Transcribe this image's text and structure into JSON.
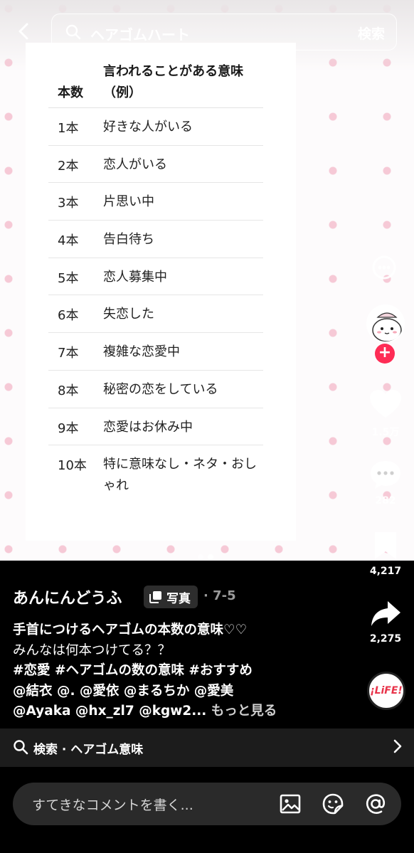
{
  "search": {
    "query": "ヘアゴムハート",
    "button_label": "検索"
  },
  "table": {
    "header_num": "本数",
    "header_meaning_1": "言われることがある意味",
    "header_meaning_2": "（例）",
    "rows": [
      {
        "num": "1本",
        "meaning": "好きな人がいる"
      },
      {
        "num": "2本",
        "meaning": "恋人がいる"
      },
      {
        "num": "3本",
        "meaning": "片思い中"
      },
      {
        "num": "4本",
        "meaning": "告白待ち"
      },
      {
        "num": "5本",
        "meaning": "恋人募集中"
      },
      {
        "num": "6本",
        "meaning": "失恋した"
      },
      {
        "num": "7本",
        "meaning": "複雑な恋愛中"
      },
      {
        "num": "8本",
        "meaning": "秘密の恋をしている"
      },
      {
        "num": "9本",
        "meaning": "恋愛はお休み中"
      },
      {
        "num": "10本",
        "meaning": "特に意味なし・ネタ・おしゃれ"
      }
    ]
  },
  "actions": {
    "likes": "1.5万",
    "comments": "282",
    "bookmarks": "4,217",
    "shares": "2,275",
    "music_label": "¡LiFE!"
  },
  "post": {
    "author": "あんにんどうふ",
    "badge": "写真",
    "date": "· 7-5",
    "title": "手首につけるヘアゴムの本数の意味♡♡",
    "line2": "みんなは何本つけてる？？",
    "tags": "#恋愛 #ヘアゴムの数の意味 #おすすめ",
    "mentions1": "@結衣 @. @愛依 @まるちか @愛美",
    "mentions2": "@Ayaka @hx_zl7 @kgw2...",
    "more": "もっと見る"
  },
  "related": {
    "label": "検索 · ヘアゴム意味"
  },
  "comment": {
    "placeholder": "すてきなコメントを書く..."
  },
  "colors": {
    "accent": "#fe2c55",
    "star": "#f6c9d6"
  }
}
